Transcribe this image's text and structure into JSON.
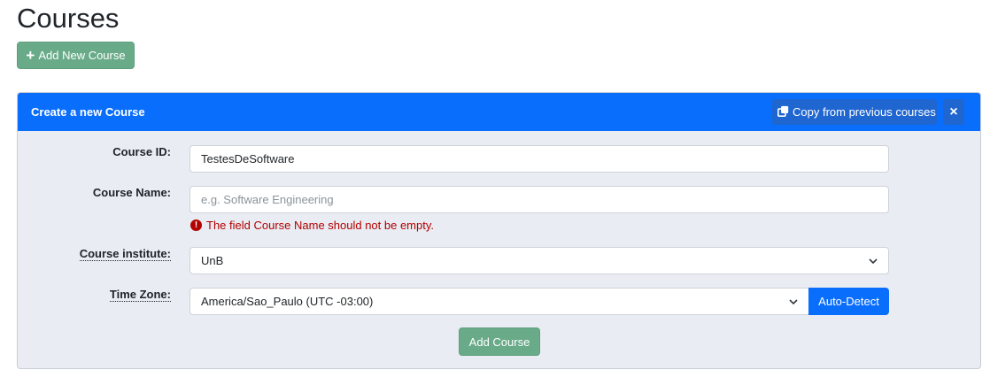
{
  "page": {
    "title": "Courses",
    "add_new_label": "Add New Course",
    "add_new_icon": "plus-icon"
  },
  "card": {
    "title": "Create a new Course",
    "copy_label": "Copy from previous courses",
    "copy_icon": "copy-icon",
    "close_symbol": "×",
    "header_color": "#0a6efd"
  },
  "form": {
    "course_id": {
      "label": "Course ID:",
      "value": "TestesDeSoftware"
    },
    "course_name": {
      "label": "Course Name:",
      "value": "",
      "placeholder": "e.g. Software Engineering",
      "error": "The field Course Name should not be empty.",
      "error_icon": "exclamation-circle-icon"
    },
    "institute": {
      "label": "Course institute:",
      "selected": "UnB"
    },
    "timezone": {
      "label": "Time Zone:",
      "selected": "America/Sao_Paulo (UTC -03:00)",
      "auto_detect_label": "Auto-Detect"
    },
    "submit_label": "Add Course",
    "submit_color": "#69ab89",
    "error_color": "#b30000"
  }
}
